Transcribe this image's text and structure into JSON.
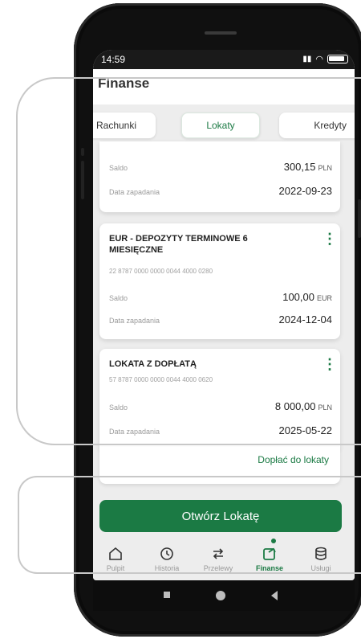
{
  "status": {
    "time": "14:59"
  },
  "appbar": {
    "title": "Finanse"
  },
  "tabs": [
    {
      "label": "Rachunki"
    },
    {
      "label": "Lokaty"
    },
    {
      "label": "Kredyty"
    }
  ],
  "active_tab": "Lokaty",
  "cards": [
    {
      "saldo_label": "Saldo",
      "saldo_amount": "300,15",
      "saldo_currency": "PLN",
      "date_label": "Data zapadania",
      "date_value": "2022-09-23"
    },
    {
      "title": "EUR - DEPOZYTY TERMINOWE 6 MIESIĘCZNE",
      "account": "22 8787 0000 0000 0044 4000 0280",
      "saldo_label": "Saldo",
      "saldo_amount": "100,00",
      "saldo_currency": "EUR",
      "date_label": "Data zapadania",
      "date_value": "2024-12-04"
    },
    {
      "title": "LOKATA Z DOPŁATĄ",
      "account": "57 8787 0000 0000 0044 4000 0620",
      "saldo_label": "Saldo",
      "saldo_amount": "8 000,00",
      "saldo_currency": "PLN",
      "date_label": "Data zapadania",
      "date_value": "2025-05-22"
    }
  ],
  "topup_link": "Dopłać do lokaty",
  "open_button": "Otwórz Lokatę",
  "bottom_nav": [
    {
      "label": "Pulpit",
      "icon": "home-icon"
    },
    {
      "label": "Historia",
      "icon": "history-icon"
    },
    {
      "label": "Przelewy",
      "icon": "transfer-icon"
    },
    {
      "label": "Finanse",
      "icon": "finance-icon"
    },
    {
      "label": "Usługi",
      "icon": "services-icon"
    }
  ],
  "active_nav": "Finanse",
  "colors": {
    "accent": "#1b7a44",
    "background": "#ededed"
  }
}
